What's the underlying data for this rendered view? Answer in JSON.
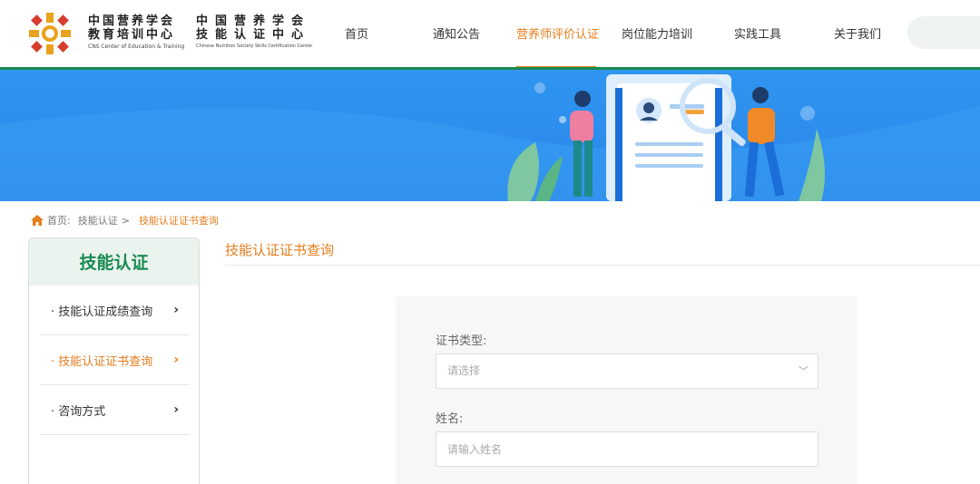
{
  "header": {
    "logo1_cn_line1": "中国营养学会",
    "logo1_cn_line2": "教育培训中心",
    "logo1_en": "CNS Center of Education & Training",
    "logo2_cn_line1": "中国营养学会",
    "logo2_cn_line2": "技能认证中心",
    "logo2_en": "Chinese Nutrition Society Skills Certification Center"
  },
  "nav": {
    "items": [
      {
        "label": "首页"
      },
      {
        "label": "通知公告"
      },
      {
        "label": "营养师评价认证"
      },
      {
        "label": "岗位能力培训"
      },
      {
        "label": "实践工具"
      },
      {
        "label": "关于我们"
      }
    ],
    "active_index": 2
  },
  "breadcrumb": {
    "home": "首页:",
    "level1": "技能认证",
    "sep": ">",
    "current": "技能认证证书查询"
  },
  "sidebar": {
    "title": "技能认证",
    "items": [
      {
        "label": "· 技能认证成绩查询",
        "chevron": "›"
      },
      {
        "label": "· 技能认证证书查询",
        "chevron": "›"
      },
      {
        "label": "· 咨询方式",
        "chevron": "›"
      }
    ],
    "active_index": 1
  },
  "main": {
    "title": "技能认证证书查询",
    "form": {
      "cert_type_label": "证书类型:",
      "cert_type_placeholder": "请选择",
      "name_label": "姓名:",
      "name_placeholder": "请输入姓名"
    }
  },
  "colors": {
    "brand_green": "#1a8a52",
    "accent_orange": "#e47d1e",
    "banner_blue": "#2f95f0"
  }
}
